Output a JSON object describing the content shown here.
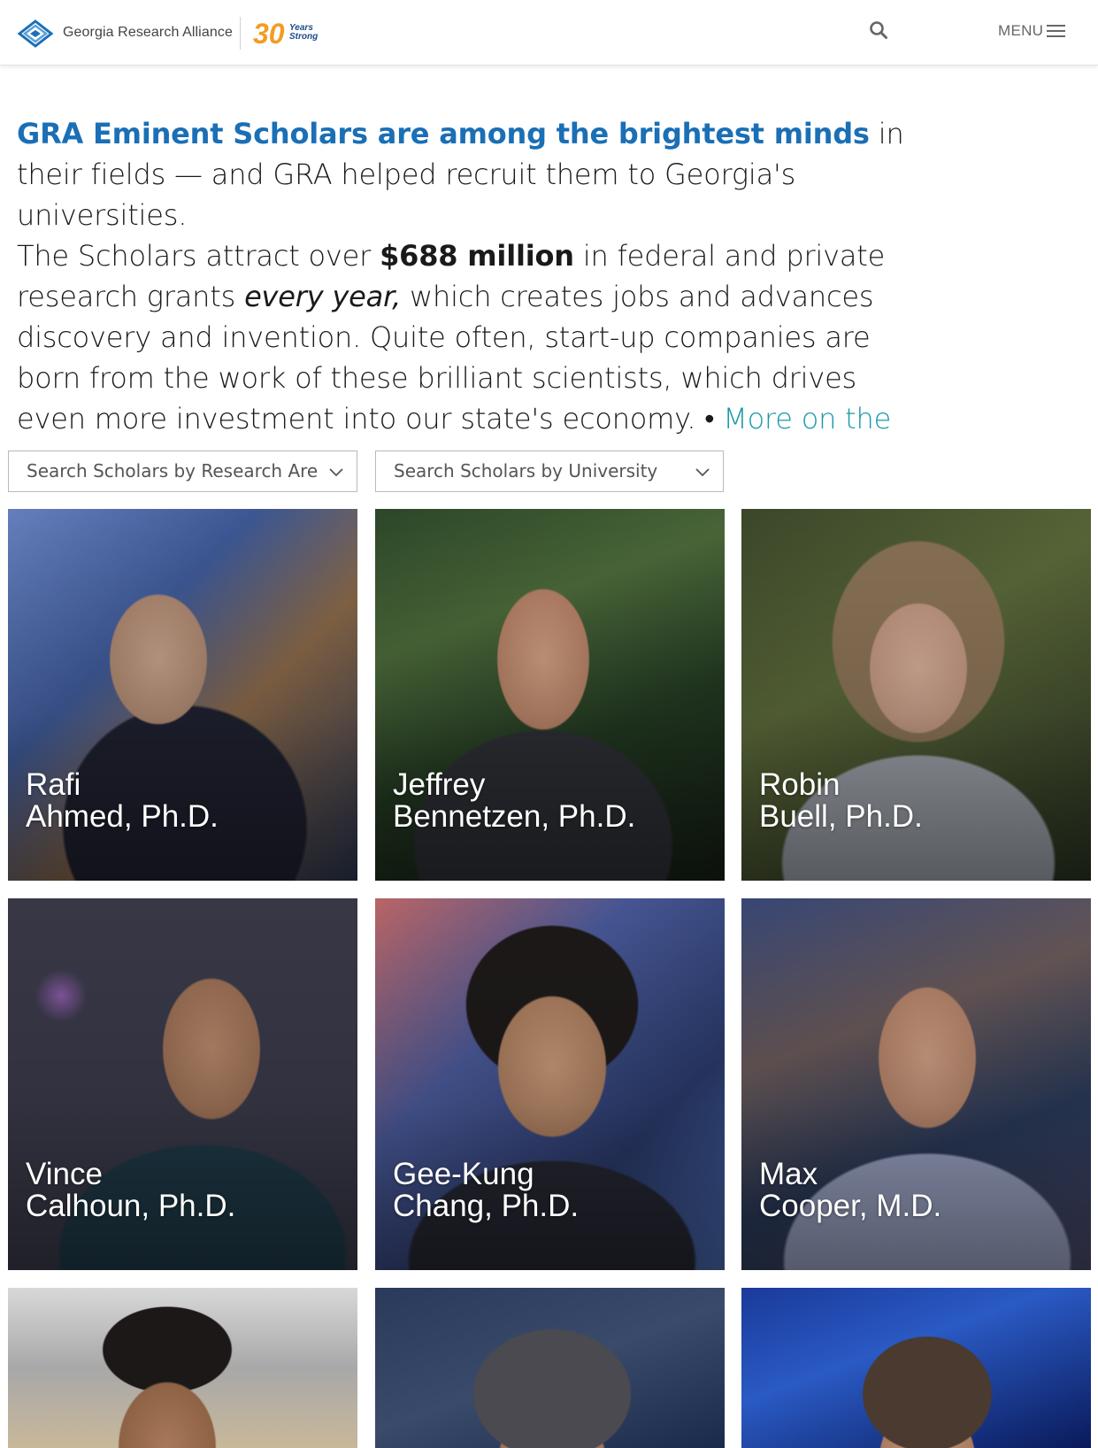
{
  "header": {
    "logo_text": "Georgia Research Alliance",
    "anniversary_number": "30",
    "anniversary_line1": "Years",
    "anniversary_line2": "Strong",
    "search_icon": "search-icon",
    "menu_label": "MENU",
    "menu_icon": "hamburger-icon"
  },
  "intro": {
    "lead": "GRA Eminent Scholars are among the brightest minds",
    "text1": " in their fields — and GRA helped recruit them to Georgia's universities.",
    "text2": "The Scholars attract over ",
    "money": "$688 million",
    "text3": " in federal and private research grants ",
    "emphasis": "every year,",
    "text4": " which creates jobs and advances discovery and invention. Quite often, start-up companies are born from the work of these brilliant scientists, which drives even more investment into our state's economy. • ",
    "more_link": "More on the program >"
  },
  "filters": {
    "research_area_placeholder": "Search Scholars by Research Are",
    "university_placeholder": "Search Scholars by University"
  },
  "scholars": [
    {
      "first": "Rafi",
      "last": "Ahmed, Ph.D."
    },
    {
      "first": "Jeffrey",
      "last": "Bennetzen, Ph.D."
    },
    {
      "first": "Robin",
      "last": "Buell, Ph.D."
    },
    {
      "first": "Vince",
      "last": "Calhoun, Ph.D."
    },
    {
      "first": "Gee-Kung",
      "last": "Chang, Ph.D."
    },
    {
      "first": "Max",
      "last": "Cooper, M.D."
    }
  ],
  "colors": {
    "brand_blue": "#1a6fb5",
    "link_teal": "#1a9aa6",
    "anniversary_orange": "#f39c24"
  }
}
